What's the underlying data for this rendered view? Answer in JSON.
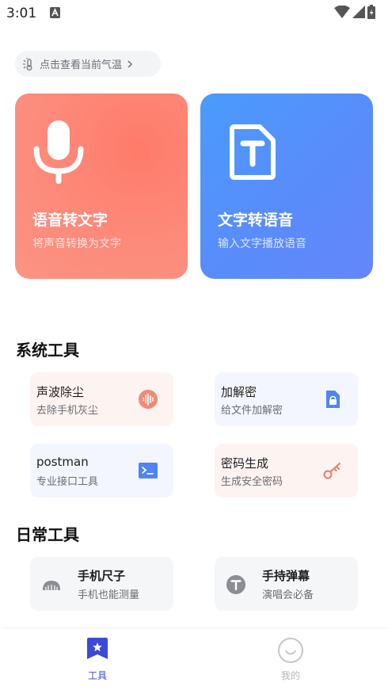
{
  "status_bar": {
    "time": "3:01"
  },
  "weather": {
    "label": "点击查看当前气温"
  },
  "cards": [
    {
      "title": "语音转文字",
      "subtitle": "将声音转换为文字"
    },
    {
      "title": "文字转语音",
      "subtitle": "输入文字播放语音"
    }
  ],
  "system_tools": {
    "title": "系统工具",
    "items": [
      {
        "name": "声波除尘",
        "desc": "去除手机灰尘",
        "icon": "sound-wave-icon"
      },
      {
        "name": "加解密",
        "desc": "给文件加解密",
        "icon": "lock-file-icon"
      },
      {
        "name": "postman",
        "desc": "专业接口工具",
        "icon": "terminal-icon"
      },
      {
        "name": "密码生成",
        "desc": "生成安全密码",
        "icon": "key-icon"
      }
    ]
  },
  "daily_tools": {
    "title": "日常工具",
    "items": [
      {
        "name": "手机尺子",
        "desc": "手机也能测量",
        "icon": "ruler-icon"
      },
      {
        "name": "手持弹幕",
        "desc": "演唱会必备",
        "icon": "t-circle-icon"
      }
    ]
  },
  "nav": {
    "tools": "工具",
    "mine": "我的"
  },
  "colors": {
    "accent": "#3b4ad6",
    "voice_card": "#fd8878",
    "tts_card": "#5a8bfb"
  }
}
